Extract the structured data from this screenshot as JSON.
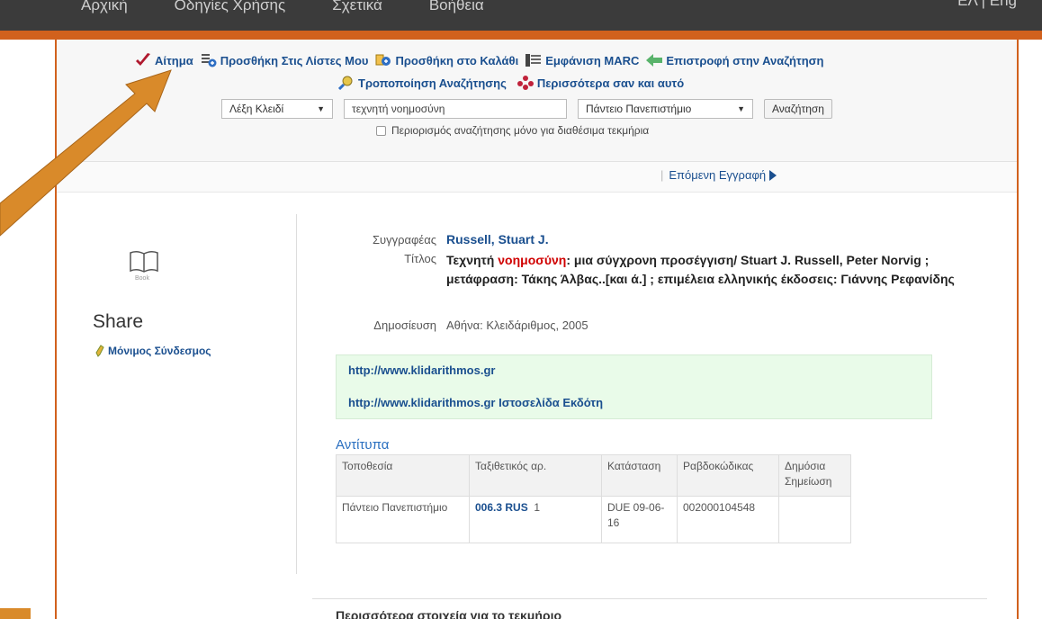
{
  "nav": {
    "items": [
      "Αρχική",
      "Οδηγίες Χρήσης",
      "Σχετικά",
      "Βοήθεια"
    ],
    "lang": "ΕΛ | Eng"
  },
  "actions": {
    "request": "Αίτημα",
    "add_lists": "Προσθήκη Στις Λίστες Μου",
    "add_cart": "Προσθήκη στο Καλάθι",
    "marc": "Εμφάνιση MARC",
    "back_search": "Επιστροφή στην Αναζήτηση",
    "modify_search": "Τροποποίηση Αναζήτησης",
    "more_like": "Περισσότερα σαν και αυτό"
  },
  "search": {
    "field_select": "Λέξη Κλειδί",
    "query": "τεχνητή νοημοσύνη",
    "library_select": "Πάντειο Πανεπιστήμιο",
    "submit": "Αναζήτηση",
    "limit_label": "Περιορισμός αναζήτησης μόνο για διαθέσιμα τεκμήρια"
  },
  "next_record": "Επόμενη Εγγραφή",
  "left": {
    "book_caption": "Book",
    "share": "Share",
    "permalink": "Μόνιμος Σύνδεσμος"
  },
  "record": {
    "author_label": "Συγγραφέας",
    "author": "Russell, Stuart J.",
    "title_label": "Τίτλος",
    "title_pre": "Τεχνητή ",
    "title_hl": "νοημοσύνη",
    "title_post": ": μια σύγχρονη προσέγγιση/ Stuart J. Russell, Peter Norvig ; μετάφραση: Τάκης Άλβας..[και ά.] ; επιμέλεια ελληνικής έκδοσεις: Γιάννης Ρεφανίδης",
    "pub_label": "Δημοσίευση",
    "pub": "Αθήνα: Κλειδάριθμος, 2005"
  },
  "links": {
    "link1": "http://www.klidarithmos.gr",
    "link2": "http://www.klidarithmos.gr Ιστοσελίδα Εκδότη"
  },
  "copies": {
    "title": "Αντίτυπα",
    "headers": [
      "Τοποθεσία",
      "Ταξιθετικός αρ.",
      "Κατάσταση",
      "Ραβδοκώδικας",
      "Δημόσια Σημείωση"
    ],
    "row": {
      "location": "Πάντειο Πανεπιστήμιο",
      "callno": "006.3 RUS",
      "copy": "1",
      "status": "DUE 09-06-16",
      "barcode": "002000104548",
      "note": ""
    }
  },
  "more_info": "Περισσότερα στοιχεία για το τεκμήριο",
  "colors": {
    "accent": "#d1611d",
    "link": "#1a4f8f",
    "highlight": "#d00000",
    "annotation_arrow": "#d98a2a"
  }
}
